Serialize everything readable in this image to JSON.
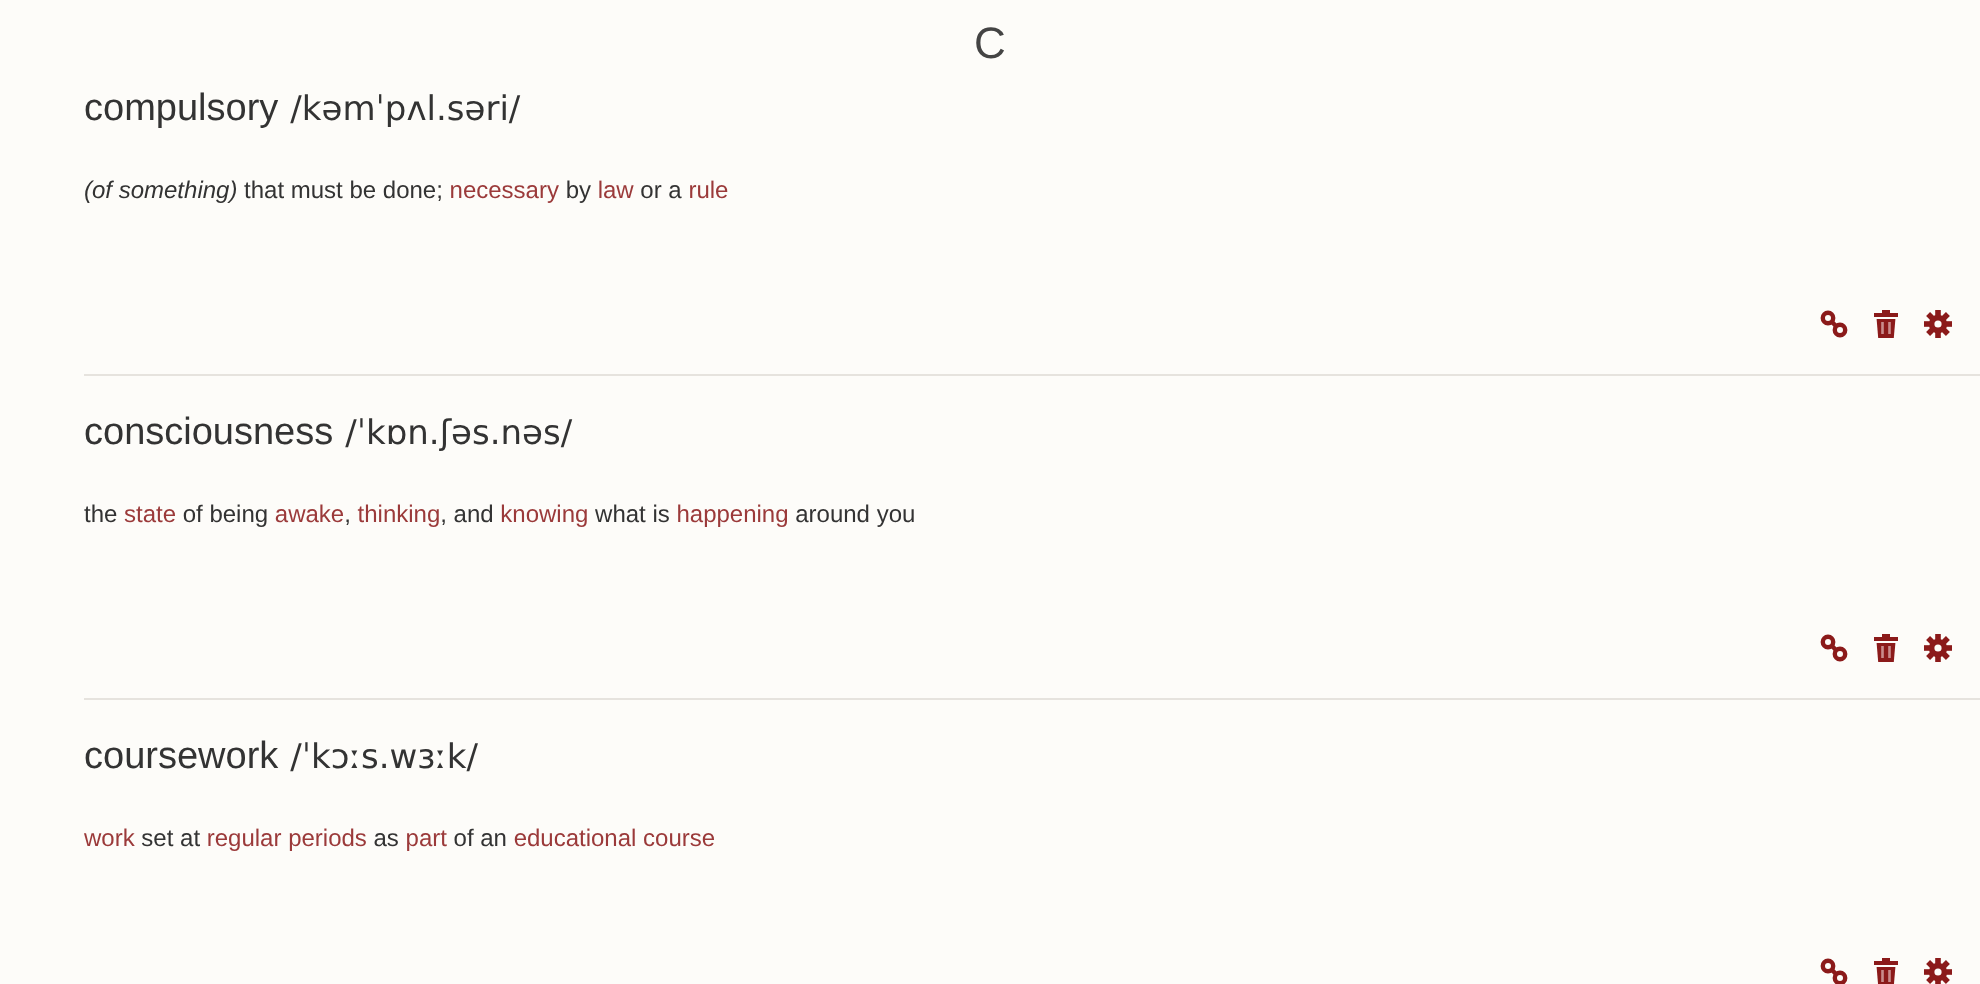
{
  "section_letter": "C",
  "entries": [
    {
      "word": "compulsory",
      "pronunciation": "/kəmˈpʌl.səri/",
      "definition": [
        {
          "kind": "italic",
          "text": "(of something)"
        },
        {
          "kind": "plain",
          "text": " that must be done; "
        },
        {
          "kind": "link",
          "text": "necessary"
        },
        {
          "kind": "plain",
          "text": " by "
        },
        {
          "kind": "link",
          "text": "law"
        },
        {
          "kind": "plain",
          "text": " or a "
        },
        {
          "kind": "link",
          "text": "rule"
        }
      ]
    },
    {
      "word": "consciousness",
      "pronunciation": "/ˈkɒn.ʃəs.nəs/",
      "definition": [
        {
          "kind": "plain",
          "text": "the "
        },
        {
          "kind": "link",
          "text": "state"
        },
        {
          "kind": "plain",
          "text": " of being "
        },
        {
          "kind": "link",
          "text": "awake"
        },
        {
          "kind": "plain",
          "text": ", "
        },
        {
          "kind": "link",
          "text": "thinking"
        },
        {
          "kind": "plain",
          "text": ", and "
        },
        {
          "kind": "link",
          "text": "knowing"
        },
        {
          "kind": "plain",
          "text": " what is "
        },
        {
          "kind": "link",
          "text": "happening"
        },
        {
          "kind": "plain",
          "text": " around you"
        }
      ]
    },
    {
      "word": "coursework",
      "pronunciation": "/ˈkɔːs.wɜːk/",
      "definition": [
        {
          "kind": "link",
          "text": "work"
        },
        {
          "kind": "plain",
          "text": " set at "
        },
        {
          "kind": "link",
          "text": "regular periods"
        },
        {
          "kind": "plain",
          "text": " as "
        },
        {
          "kind": "link",
          "text": "part"
        },
        {
          "kind": "plain",
          "text": " of an "
        },
        {
          "kind": "link",
          "text": "educational course"
        }
      ]
    }
  ]
}
